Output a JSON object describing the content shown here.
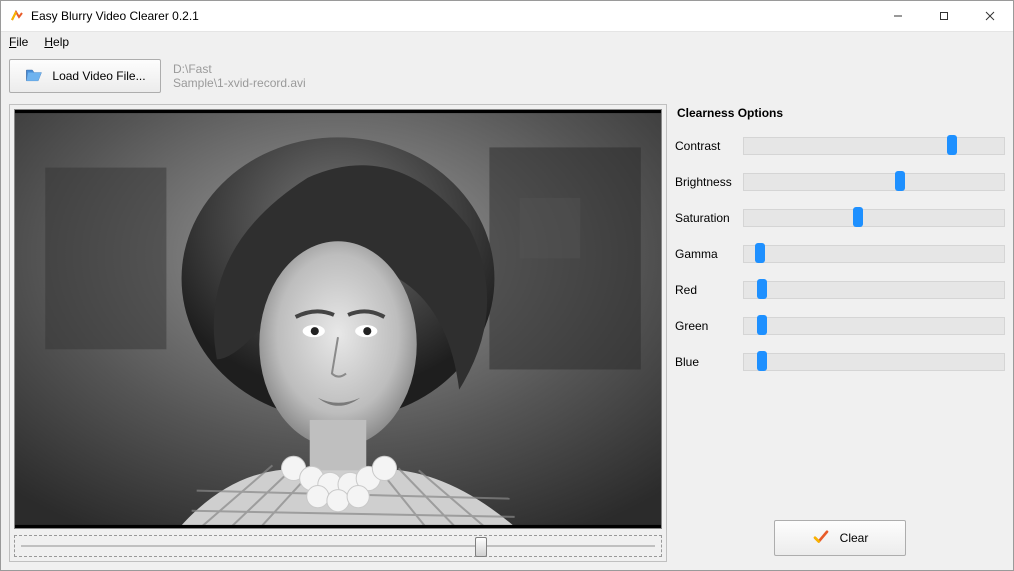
{
  "window": {
    "title": "Easy Blurry Video Clearer 0.2.1"
  },
  "menu": {
    "file": "File",
    "help": "Help"
  },
  "toolbar": {
    "load_label": "Load Video File...",
    "path_line1": "D:\\Fast",
    "path_line2": "Sample\\1-xvid-record.avi"
  },
  "seek": {
    "position_pct": 72
  },
  "options": {
    "title": "Clearness Options",
    "sliders": [
      {
        "label": "Contrast",
        "value_pct": 80
      },
      {
        "label": "Brightness",
        "value_pct": 60
      },
      {
        "label": "Saturation",
        "value_pct": 44
      },
      {
        "label": "Gamma",
        "value_pct": 6
      },
      {
        "label": "Red",
        "value_pct": 7
      },
      {
        "label": "Green",
        "value_pct": 7
      },
      {
        "label": "Blue",
        "value_pct": 7
      }
    ],
    "clear_label": "Clear"
  }
}
